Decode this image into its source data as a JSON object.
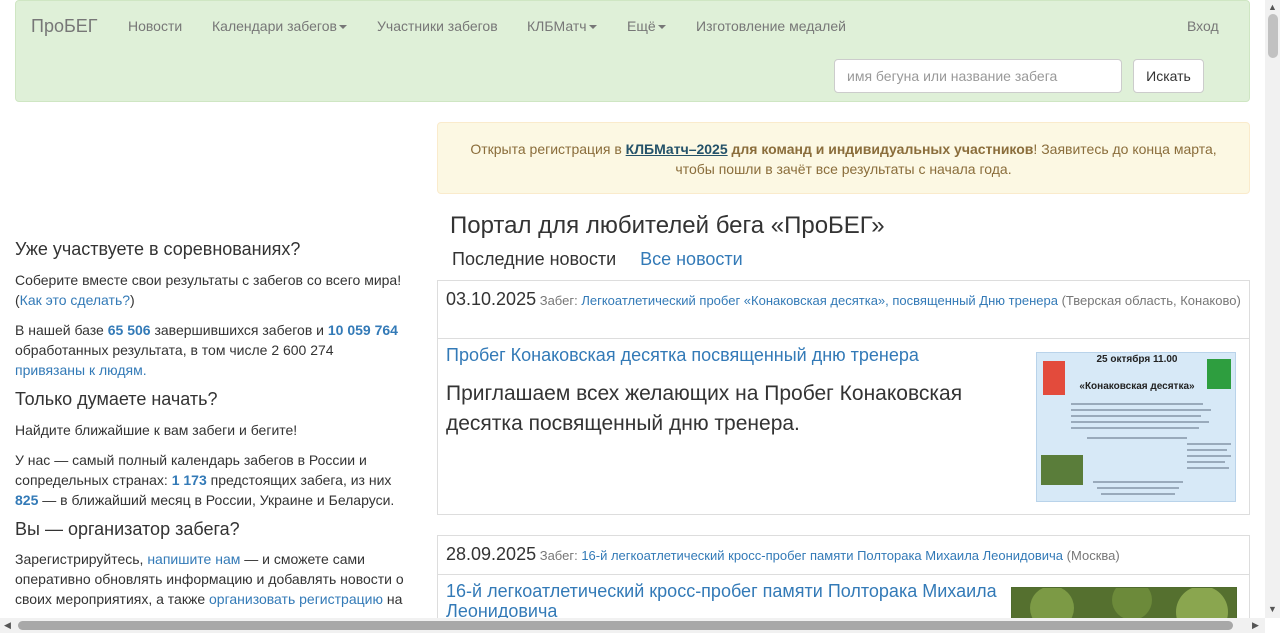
{
  "navbar": {
    "brand": "ПроБЕГ",
    "items": [
      {
        "label": "Новости"
      },
      {
        "label": "Календари забегов"
      },
      {
        "label": "Участники забегов"
      },
      {
        "label": "КЛБМатч"
      },
      {
        "label": "Ещё"
      },
      {
        "label": "Изготовление медалей"
      }
    ],
    "login": "Вход",
    "search_placeholder": "имя бегуна или название забега",
    "search_button": "Искать"
  },
  "alert": {
    "prefix": "Открыта регистрация в ",
    "link": "КЛБМатч–2025",
    "bold": " для команд и индивидуальных участников",
    "suffix": "! Заявитесь до конца марта, чтобы пошли в зачёт все результаты с начала года."
  },
  "main": {
    "title": "Портал для любителей бега «ПроБЕГ»",
    "tab_latest": "Последние новости",
    "tab_all": "Все новости"
  },
  "left": {
    "h1": "Уже участвуете в соревнованиях?",
    "p1": "Соберите вместе свои результаты с забегов со всего мира!",
    "p1_open": "(",
    "p1_link": "Как это сделать?",
    "p1_close": ")",
    "p2_a": "В нашей базе ",
    "p2_races": "65 506",
    "p2_b": " завершившихся забегов и ",
    "p2_results": "10 059 764",
    "p2_c": " обработанных результата, в том числе 2 600 274 ",
    "p2_link": "привязаны к людям.",
    "h2": "Только думаете начать?",
    "p3": "Найдите ближайшие к вам забеги и бегите!",
    "p4_a": "У нас — самый полный календарь забегов в России и сопредельных странах: ",
    "p4_upcoming": "1 173",
    "p4_b": " предстоящих забега, из них ",
    "p4_month": "825",
    "p4_c": " — в ближайший месяц в России, Украине и Беларуси.",
    "h3": "Вы — организатор забега?",
    "p5_a": "Зарегистрируйтесь, ",
    "p5_link1": "напишите нам",
    "p5_b": " — и сможете сами оперативно обновлять информацию и добавлять новости о своих мероприятиях, а также ",
    "p5_link2": "организовать регистрацию",
    "p5_c": " на"
  },
  "news": [
    {
      "date": "03.10.2025",
      "race_label": "Забег:",
      "race": "Легкоатлетический пробег «Конаковская десятка», посвященный Дню тренера",
      "place": "(Тверская область, Конаково)",
      "title": "Пробег Конаковская десятка посвященный дню тренера",
      "text": "Приглашаем всех желающих на Пробег Конаковская десятка посвященный дню тренера.",
      "poster_date": "25 октября 11.00",
      "poster_title": "«Конаковская десятка»"
    },
    {
      "date": "28.09.2025",
      "race_label": "Забег:",
      "race": "16-й легкоатлетический кросс-пробег памяти Полторака Михаила Леонидовича",
      "place": "(Москва)",
      "title": "16-й легкоатлетический кросс-пробег памяти Полторака Михаила Леонидовича"
    }
  ]
}
